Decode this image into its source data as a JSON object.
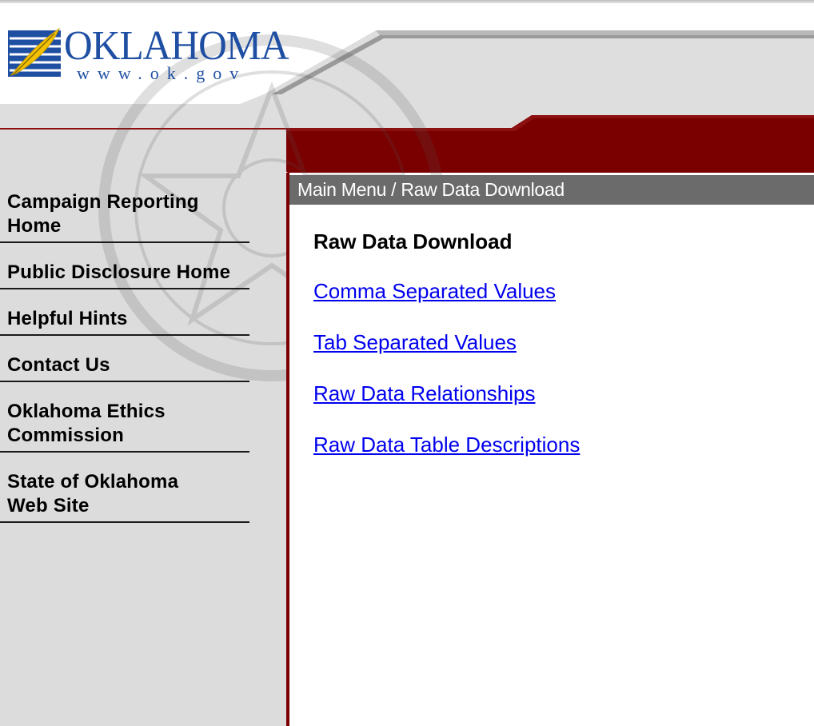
{
  "logo": {
    "wordmark": "OKLAHOMA",
    "url_text": "www.ok.gov"
  },
  "sidebar": {
    "items": [
      {
        "label": "Campaign Reporting\nHome"
      },
      {
        "label": "Public Disclosure Home"
      },
      {
        "label": "Helpful Hints"
      },
      {
        "label": "Contact Us"
      },
      {
        "label": "Oklahoma Ethics\nCommission"
      },
      {
        "label": "State of Oklahoma\nWeb Site"
      }
    ]
  },
  "breadcrumb": {
    "text": "Main Menu / Raw Data Download"
  },
  "main": {
    "title": "Raw Data Download",
    "links": [
      {
        "label": "Comma Separated Values"
      },
      {
        "label": "Tab Separated Values"
      },
      {
        "label": "Raw Data Relationships"
      },
      {
        "label": "Raw Data Table Descriptions"
      }
    ]
  },
  "colors": {
    "brand_blue": "#1f4fa3",
    "maroon": "#7a0000",
    "crumb_gray": "#6b6b6b",
    "sidebar_gray": "#dcdcdc",
    "link_blue": "#0000ee"
  }
}
